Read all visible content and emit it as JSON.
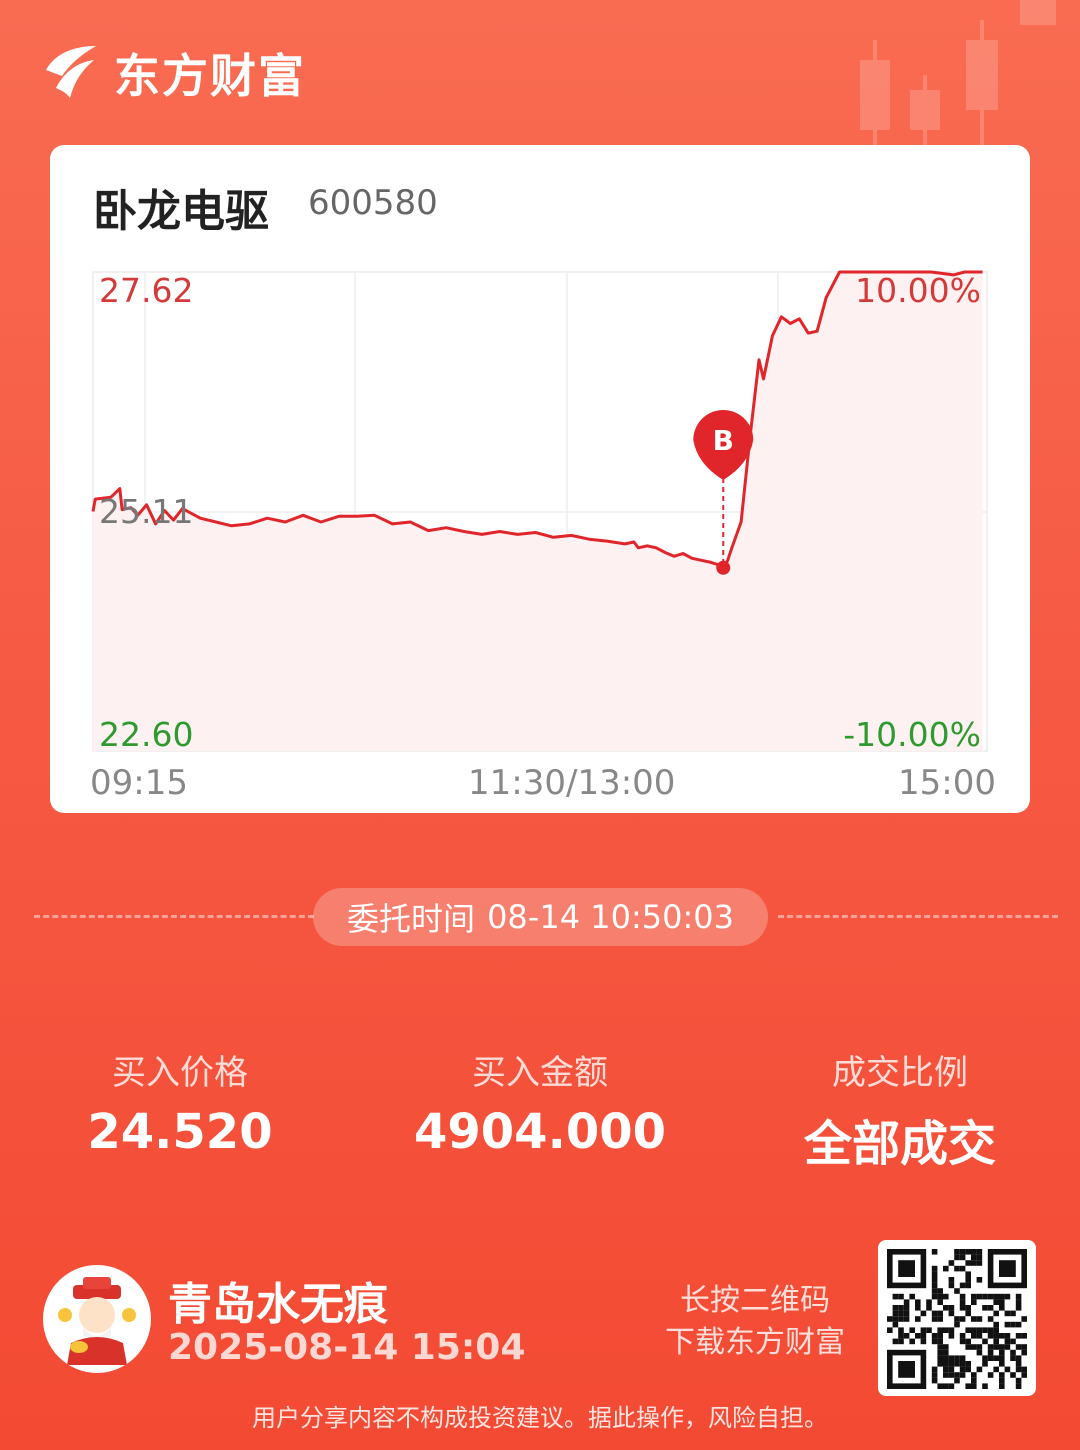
{
  "brand": {
    "name": "东方财富",
    "logo_icon": "eastmoney-logo-icon"
  },
  "stock": {
    "name": "卧龙电驱",
    "code": "600580"
  },
  "chart_data": {
    "type": "line",
    "price_labels": {
      "high": "27.62",
      "mid": "25.11",
      "low": "22.60"
    },
    "pct_labels": {
      "high": "10.00%",
      "low": "-10.00%"
    },
    "time_labels": {
      "start": "09:15",
      "mid": "11:30/13:00",
      "end": "15:00"
    },
    "ylim": [
      22.6,
      27.62
    ],
    "prev_close": 25.11,
    "line_color": "#e0262b",
    "series": [
      {
        "values": [
          [
            0,
            25.11
          ],
          [
            1,
            25.24
          ],
          [
            8,
            25.26
          ],
          [
            12,
            25.35
          ],
          [
            13,
            25.13
          ],
          [
            17,
            25.15
          ],
          [
            20,
            25.07
          ],
          [
            24,
            25.18
          ],
          [
            28,
            24.98
          ],
          [
            32,
            25.12
          ],
          [
            36,
            25.02
          ],
          [
            40,
            25.14
          ],
          [
            48,
            25.04
          ],
          [
            55,
            25.0
          ],
          [
            62,
            24.96
          ],
          [
            70,
            24.98
          ],
          [
            78,
            25.04
          ],
          [
            86,
            25.0
          ],
          [
            94,
            25.07
          ],
          [
            102,
            25.0
          ],
          [
            110,
            25.06
          ],
          [
            118,
            25.06
          ],
          [
            126,
            25.07
          ],
          [
            134,
            24.98
          ],
          [
            142,
            25.0
          ],
          [
            150,
            24.91
          ],
          [
            158,
            24.94
          ],
          [
            166,
            24.9
          ],
          [
            174,
            24.87
          ],
          [
            182,
            24.9
          ],
          [
            190,
            24.87
          ],
          [
            198,
            24.89
          ],
          [
            206,
            24.84
          ],
          [
            214,
            24.86
          ],
          [
            222,
            24.82
          ],
          [
            230,
            24.8
          ],
          [
            238,
            24.77
          ],
          [
            242,
            24.79
          ],
          [
            244,
            24.73
          ],
          [
            248,
            24.75
          ],
          [
            252,
            24.73
          ],
          [
            256,
            24.68
          ],
          [
            260,
            24.64
          ],
          [
            264,
            24.67
          ],
          [
            268,
            24.62
          ],
          [
            272,
            24.6
          ],
          [
            276,
            24.58
          ],
          [
            280,
            24.55
          ],
          [
            282,
            24.5
          ],
          [
            284,
            24.6
          ],
          [
            286,
            24.74
          ],
          [
            290,
            25.0
          ],
          [
            294,
            25.9
          ],
          [
            298,
            26.7
          ],
          [
            300,
            26.5
          ],
          [
            304,
            26.95
          ],
          [
            308,
            27.15
          ],
          [
            312,
            27.08
          ],
          [
            316,
            27.13
          ],
          [
            320,
            26.98
          ],
          [
            324,
            27.0
          ],
          [
            328,
            27.35
          ],
          [
            334,
            27.62
          ],
          [
            345,
            27.62
          ],
          [
            360,
            27.62
          ],
          [
            375,
            27.62
          ],
          [
            385,
            27.59
          ],
          [
            390,
            27.62
          ],
          [
            398,
            27.62
          ]
        ]
      }
    ],
    "trade_marker": {
      "label": "B",
      "time_min": 282,
      "price": 24.52,
      "color": "#e0262b"
    }
  },
  "order": {
    "label": "委托时间",
    "time": "08-14 10:50:03"
  },
  "stats": [
    {
      "label": "买入价格",
      "value": "24.520"
    },
    {
      "label": "买入金额",
      "value": "4904.000"
    },
    {
      "label": "成交比例",
      "value": "全部成交"
    }
  ],
  "user": {
    "name": "青岛水无痕",
    "time": "2025-08-14 15:04",
    "avatar_icon": "caishen-avatar-icon"
  },
  "qr": {
    "hint_line1": "长按二维码",
    "hint_line2": "下载东方财富",
    "icon": "qr-code-icon"
  },
  "disclaimer": "用户分享内容不构成投资建议。据此操作，风险自担。"
}
